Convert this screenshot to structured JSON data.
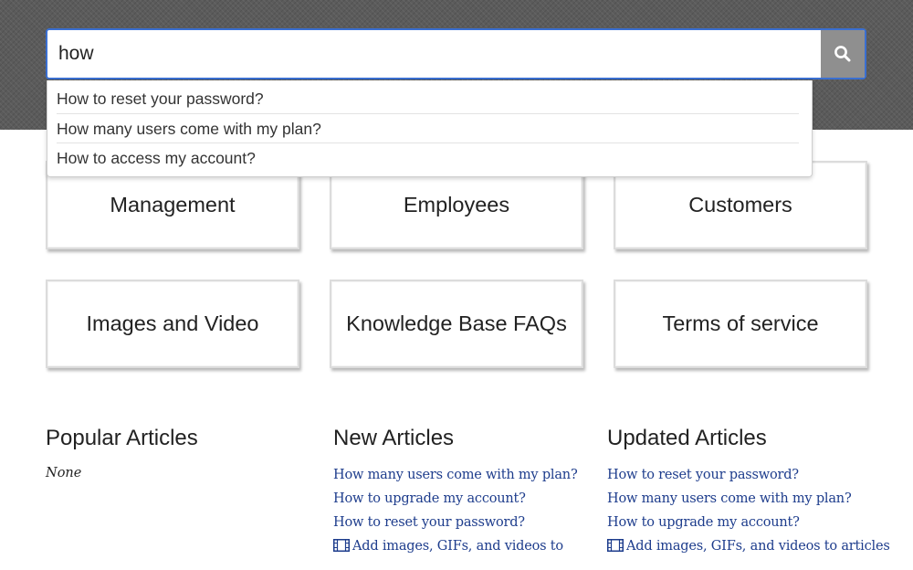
{
  "search": {
    "query": "how",
    "button_icon": "search-icon",
    "suggestions": [
      "How to reset your password?",
      "How many users come with my plan?",
      "How to access my account?"
    ]
  },
  "categories": [
    "Management",
    "Employees",
    "Customers",
    "Images and Video",
    "Knowledge Base FAQs",
    "Terms of service"
  ],
  "popular": {
    "title": "Popular Articles",
    "empty_text": "None"
  },
  "new_articles": {
    "title": "New Articles",
    "items": [
      "How many users come with my plan?",
      "How to upgrade my account?",
      "How to reset your password?",
      "Add images, GIFs, and videos to"
    ]
  },
  "updated_articles": {
    "title": "Updated Articles",
    "items": [
      "How to reset your password?",
      "How many users come with my plan?",
      "How to upgrade my account?",
      "Add images, GIFs, and videos to articles"
    ]
  },
  "colors": {
    "hero_bg": "#5b5b5b",
    "search_border": "#3a6fd1",
    "search_button": "#8f8f8f",
    "link": "#1d3c8c"
  }
}
